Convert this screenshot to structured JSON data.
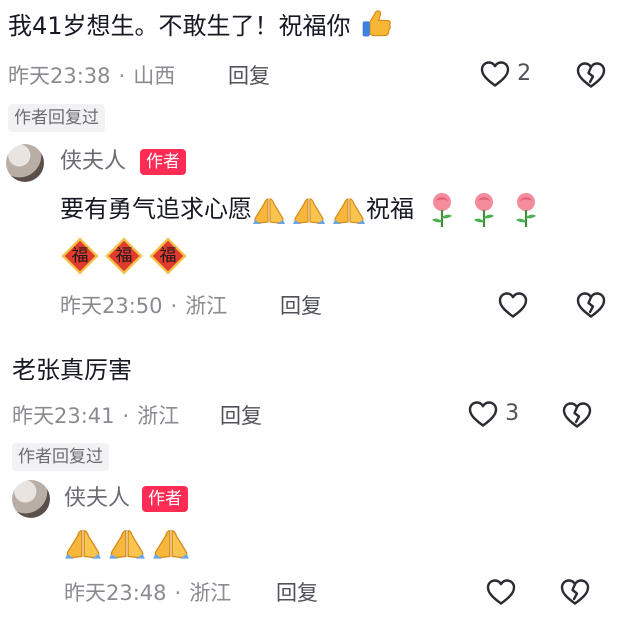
{
  "comment1": {
    "text": "我41岁想生。不敢生了！祝福你",
    "time": "昨天23:38",
    "location": "山西",
    "reply_label": "回复",
    "like_count": "2",
    "author_replied_tag": "作者回复过"
  },
  "reply1": {
    "name": "侠夫人",
    "badge": "作者",
    "text_a": "要有勇气追求心愿",
    "text_b": "祝福",
    "fu_char": "福",
    "time": "昨天23:50",
    "location": "浙江",
    "reply_label": "回复"
  },
  "comment2": {
    "text": "老张真厉害",
    "time": "昨天23:41",
    "location": "浙江",
    "reply_label": "回复",
    "like_count": "3",
    "author_replied_tag": "作者回复过"
  },
  "reply2": {
    "name": "侠夫人",
    "badge": "作者",
    "time": "昨天23:48",
    "location": "浙江",
    "reply_label": "回复"
  },
  "separator": "·",
  "icons": {
    "like": "heart-outline-icon",
    "dislike": "broken-heart-icon",
    "thumbs_up": "thumbs-up-emoji",
    "pray": "folded-hands-emoji",
    "rose": "rose-emoji",
    "fu": "fu-blessing-emoji"
  },
  "colors": {
    "author_badge": "#fe2c55",
    "meta_text": "#8a8b91",
    "tag_bg": "#f2f2f4"
  }
}
